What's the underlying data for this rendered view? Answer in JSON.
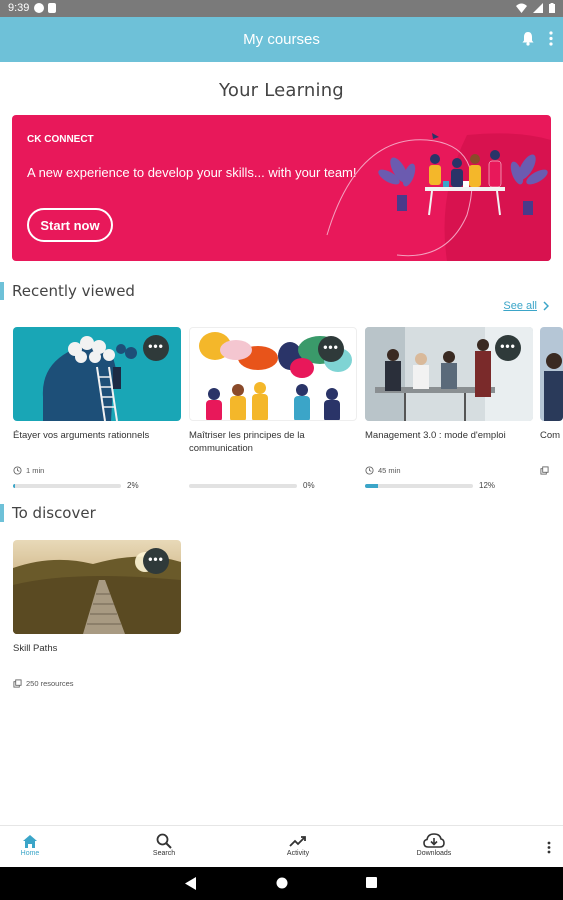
{
  "status_bar": {
    "time": "9:39"
  },
  "app_bar": {
    "title": "My courses",
    "icons": [
      "bell-icon",
      "more-vert-icon"
    ]
  },
  "page_title": "Your Learning",
  "banner": {
    "label": "CK CONNECT",
    "headline": "A new experience to develop your skills... with your team!",
    "cta": "Start now",
    "background": "#e8185a"
  },
  "recently_viewed": {
    "title": "Recently viewed",
    "see_all": "See all",
    "items": [
      {
        "title": "Étayer vos arguments rationnels",
        "duration": "1 min",
        "progress": 2,
        "progress_label": "2%"
      },
      {
        "title": "Maîtriser les principes de la communication",
        "duration": "",
        "progress": 0,
        "progress_label": "0%"
      },
      {
        "title": "Management 3.0 : mode d'emploi",
        "duration": "45 min",
        "progress": 12,
        "progress_label": "12%"
      },
      {
        "title": "Com",
        "duration": "",
        "progress": null,
        "progress_label": ""
      }
    ]
  },
  "to_discover": {
    "title": "To discover",
    "items": [
      {
        "title": "Skill Paths",
        "meta": "250 resources"
      }
    ]
  },
  "bottom_nav": {
    "items": [
      {
        "label": "Home",
        "icon": "home-icon",
        "active": true
      },
      {
        "label": "Search",
        "icon": "search-icon",
        "active": false
      },
      {
        "label": "Activity",
        "icon": "trending-up-icon",
        "active": false
      },
      {
        "label": "Downloads",
        "icon": "cloud-download-icon",
        "active": false
      }
    ]
  },
  "colors": {
    "accent": "#6ec1d8",
    "link": "#3ba5c8",
    "banner": "#e8185a"
  }
}
